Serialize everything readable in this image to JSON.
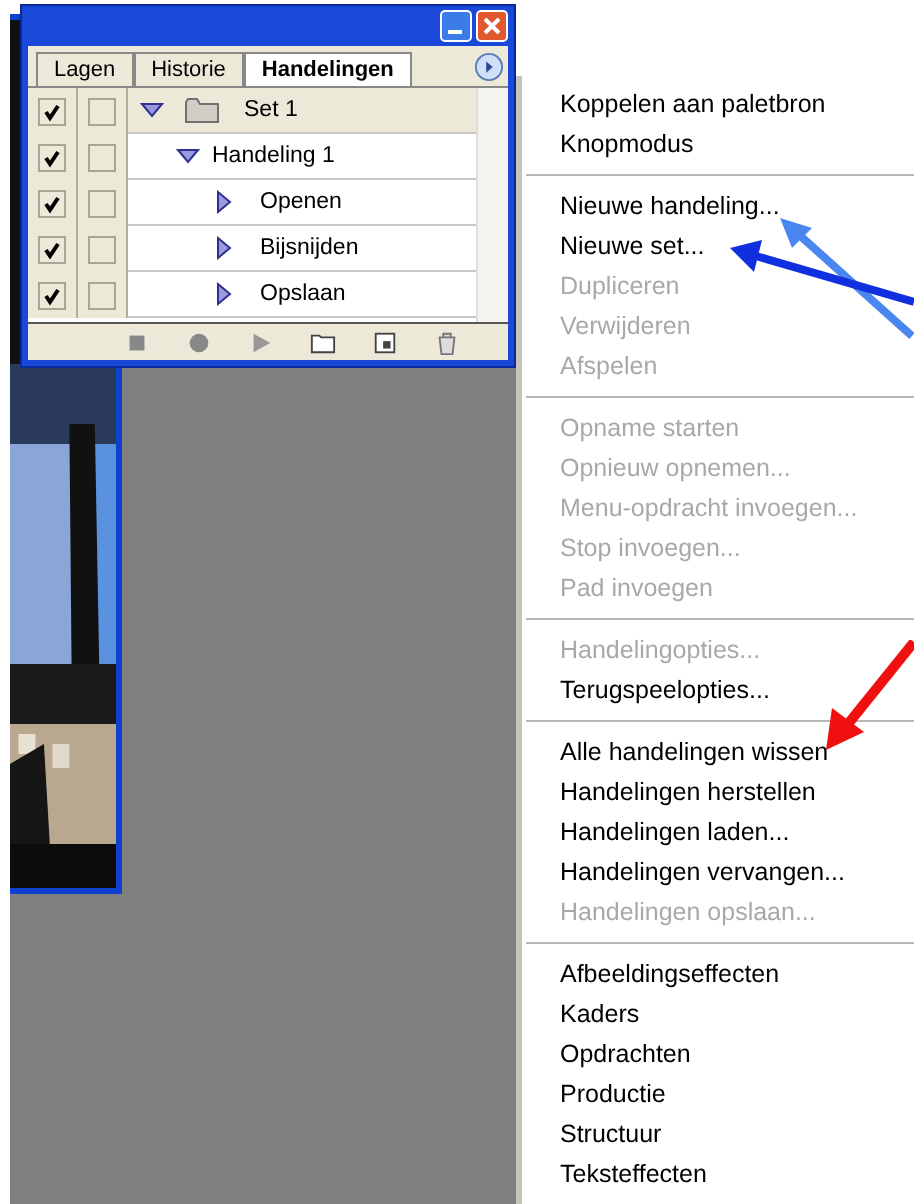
{
  "panel": {
    "tabs": [
      {
        "label": "Lagen",
        "selected": false
      },
      {
        "label": "Historie",
        "selected": false
      },
      {
        "label": "Handelingen",
        "selected": true
      }
    ],
    "tree": [
      {
        "kind": "set",
        "label": "Set 1",
        "checked": true,
        "dialog": false,
        "selected": true,
        "expanded": true,
        "children": [
          {
            "kind": "action",
            "label": "Handeling 1",
            "checked": true,
            "dialog": false,
            "selected": false,
            "expanded": true,
            "children": [
              {
                "kind": "command",
                "label": "Openen",
                "checked": true,
                "dialog": false,
                "selected": false,
                "expanded": false
              },
              {
                "kind": "command",
                "label": "Bijsnijden",
                "checked": true,
                "dialog": false,
                "selected": false,
                "expanded": false
              },
              {
                "kind": "command",
                "label": "Opslaan",
                "checked": true,
                "dialog": false,
                "selected": false,
                "expanded": false
              }
            ]
          }
        ]
      }
    ]
  },
  "menu": {
    "groups": [
      [
        {
          "label": "Koppelen aan paletbron",
          "disabled": false
        },
        {
          "label": "Knopmodus",
          "disabled": false
        }
      ],
      [
        {
          "label": "Nieuwe handeling...",
          "disabled": false
        },
        {
          "label": "Nieuwe set...",
          "disabled": false
        },
        {
          "label": "Dupliceren",
          "disabled": true
        },
        {
          "label": "Verwijderen",
          "disabled": true
        },
        {
          "label": "Afspelen",
          "disabled": true
        }
      ],
      [
        {
          "label": "Opname starten",
          "disabled": true
        },
        {
          "label": "Opnieuw opnemen...",
          "disabled": true
        },
        {
          "label": "Menu-opdracht invoegen...",
          "disabled": true
        },
        {
          "label": "Stop invoegen...",
          "disabled": true
        },
        {
          "label": "Pad invoegen",
          "disabled": true
        }
      ],
      [
        {
          "label": "Handelingopties...",
          "disabled": true
        },
        {
          "label": "Terugspeelopties...",
          "disabled": false
        }
      ],
      [
        {
          "label": "Alle handelingen wissen",
          "disabled": false
        },
        {
          "label": "Handelingen herstellen",
          "disabled": false
        },
        {
          "label": "Handelingen laden...",
          "disabled": false
        },
        {
          "label": "Handelingen vervangen...",
          "disabled": false
        },
        {
          "label": "Handelingen opslaan...",
          "disabled": true
        }
      ],
      [
        {
          "label": "Afbeeldingseffecten",
          "disabled": false
        },
        {
          "label": "Kaders",
          "disabled": false
        },
        {
          "label": "Opdrachten",
          "disabled": false
        },
        {
          "label": "Productie",
          "disabled": false
        },
        {
          "label": "Structuur",
          "disabled": false
        },
        {
          "label": "Teksteffecten",
          "disabled": false
        }
      ]
    ]
  }
}
